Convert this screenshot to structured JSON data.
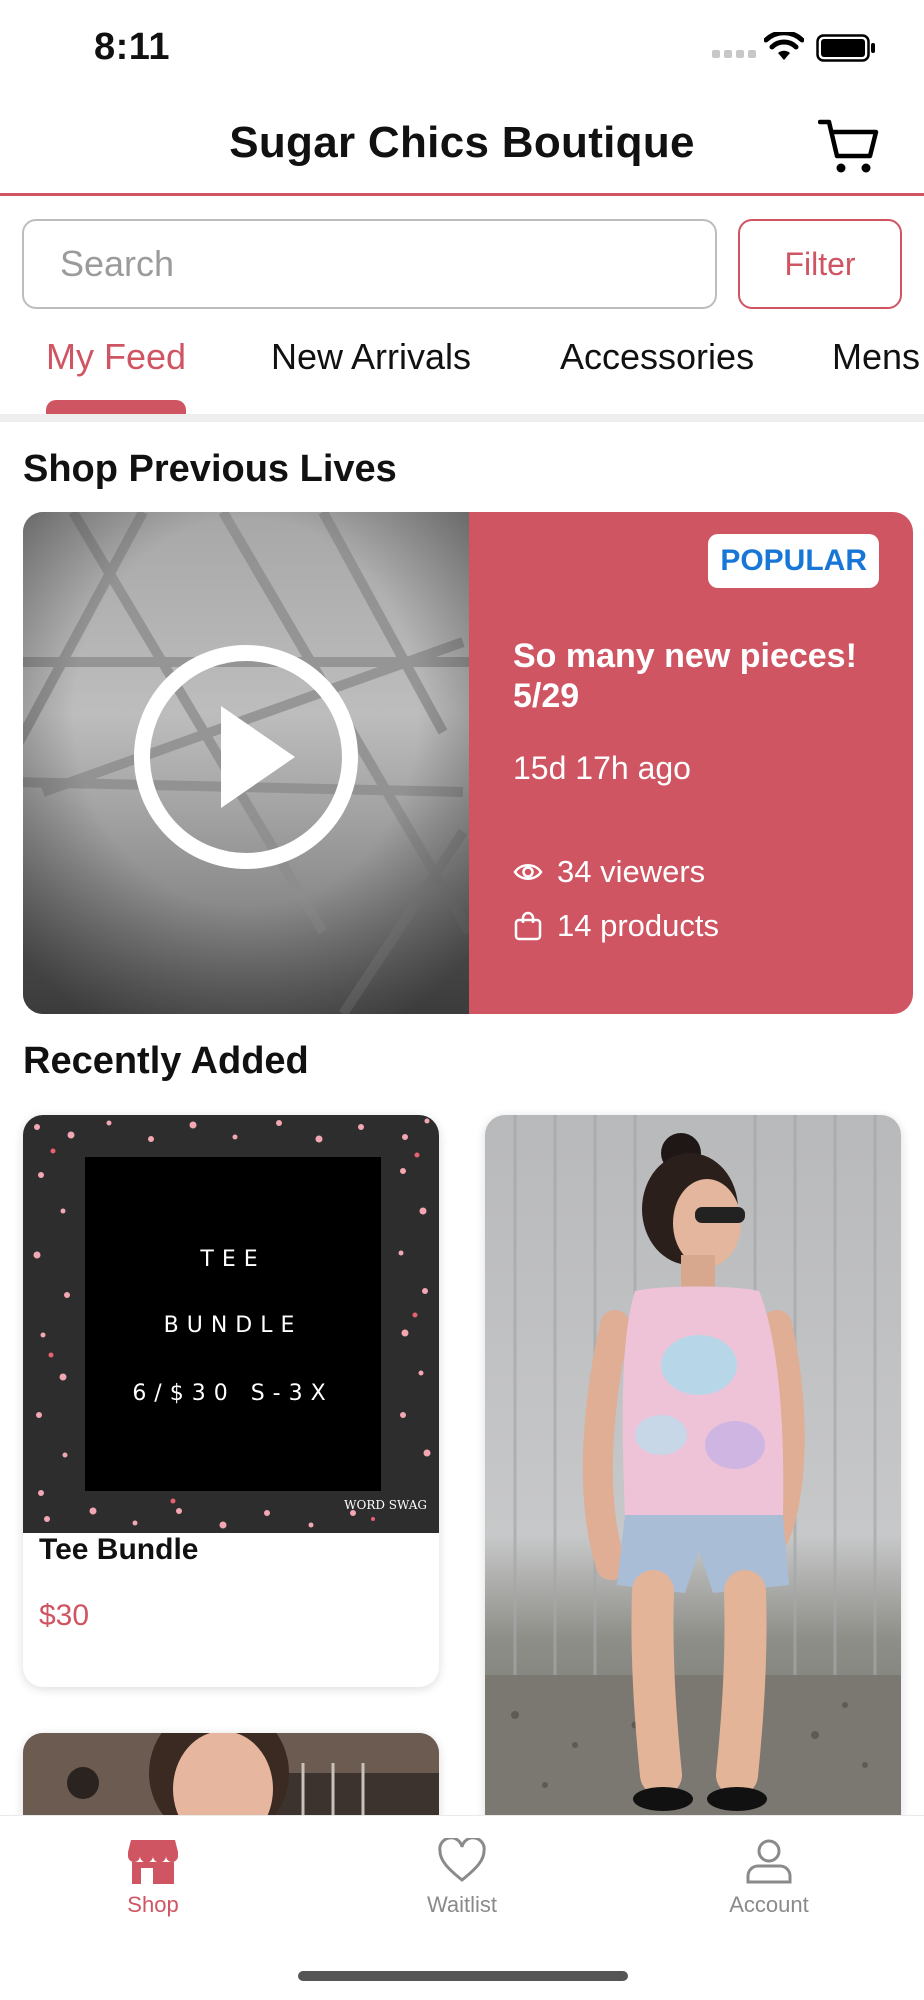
{
  "status_bar": {
    "time": "8:11"
  },
  "header": {
    "title": "Sugar Chics Boutique"
  },
  "search": {
    "placeholder": "Search",
    "filter_label": "Filter"
  },
  "tabs": [
    {
      "label": "My Feed",
      "active": true
    },
    {
      "label": "New Arrivals",
      "active": false
    },
    {
      "label": "Accessories",
      "active": false
    },
    {
      "label": "Mens",
      "active": false
    }
  ],
  "sections": {
    "previous_lives_title": "Shop Previous Lives",
    "recently_added_title": "Recently Added"
  },
  "live": {
    "badge": "POPULAR",
    "title": "So many new pieces! 5/29",
    "ago": "15d 17h ago",
    "viewers": "34 viewers",
    "products": "14 products",
    "background_color": "#cf5563"
  },
  "products": [
    {
      "name": "Tee Bundle",
      "price": "$30",
      "image_text": [
        "TEE",
        "BUNDLE",
        "6/$30 S-3X"
      ],
      "watermark": "WORD SWAG"
    }
  ],
  "bottom_nav": [
    {
      "label": "Shop",
      "icon": "store-icon",
      "active": true
    },
    {
      "label": "Waitlist",
      "icon": "heart-icon",
      "active": false
    },
    {
      "label": "Account",
      "icon": "user-icon",
      "active": false
    }
  ],
  "colors": {
    "accent": "#cf5563",
    "badge_text": "#1877d6"
  }
}
